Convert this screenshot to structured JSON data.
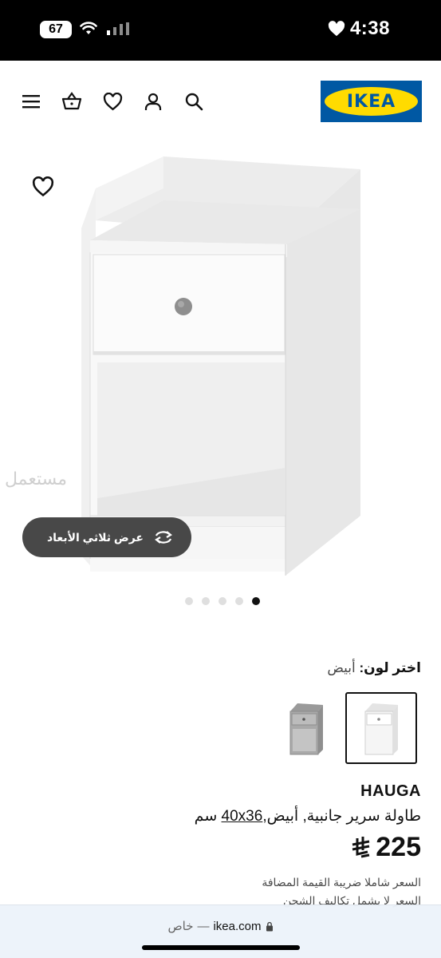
{
  "status_bar": {
    "battery_level": "67",
    "time": "4:38",
    "heart_icon": "heart-icon",
    "wifi_icon": "wifi-icon",
    "signal_icon": "signal-icon"
  },
  "header": {
    "logo_text": "IKEA",
    "icons": [
      "menu-icon",
      "basket-icon",
      "heart-icon",
      "user-icon",
      "search-icon"
    ],
    "brand_colors": {
      "blue": "#0058a3",
      "yellow": "#ffdb00"
    }
  },
  "gallery": {
    "watermark": "مستعمل",
    "view_3d_label": "عرض ثلاثي الأبعاد",
    "total_images": 5,
    "active_image_index": 4
  },
  "color_picker": {
    "label": "اختر لون:",
    "selected_value": "أبيض",
    "options": [
      "white",
      "grey"
    ]
  },
  "product": {
    "brand": "HAUGA",
    "description_prefix": "طاولة سرير جانبية, أبيض,",
    "dimensions": "40x36",
    "unit": "سم",
    "price": "225",
    "currency_symbol": "saudi-riyal-symbol",
    "vat_note": "السعر شاملا ضريبة القيمة المضافة",
    "shipping_note": "السعر لا يشمل تكاليف الشحن"
  },
  "browser": {
    "private_label": "خاص",
    "separator": "—",
    "url": "ikea.com",
    "lock_icon": "lock-icon"
  }
}
